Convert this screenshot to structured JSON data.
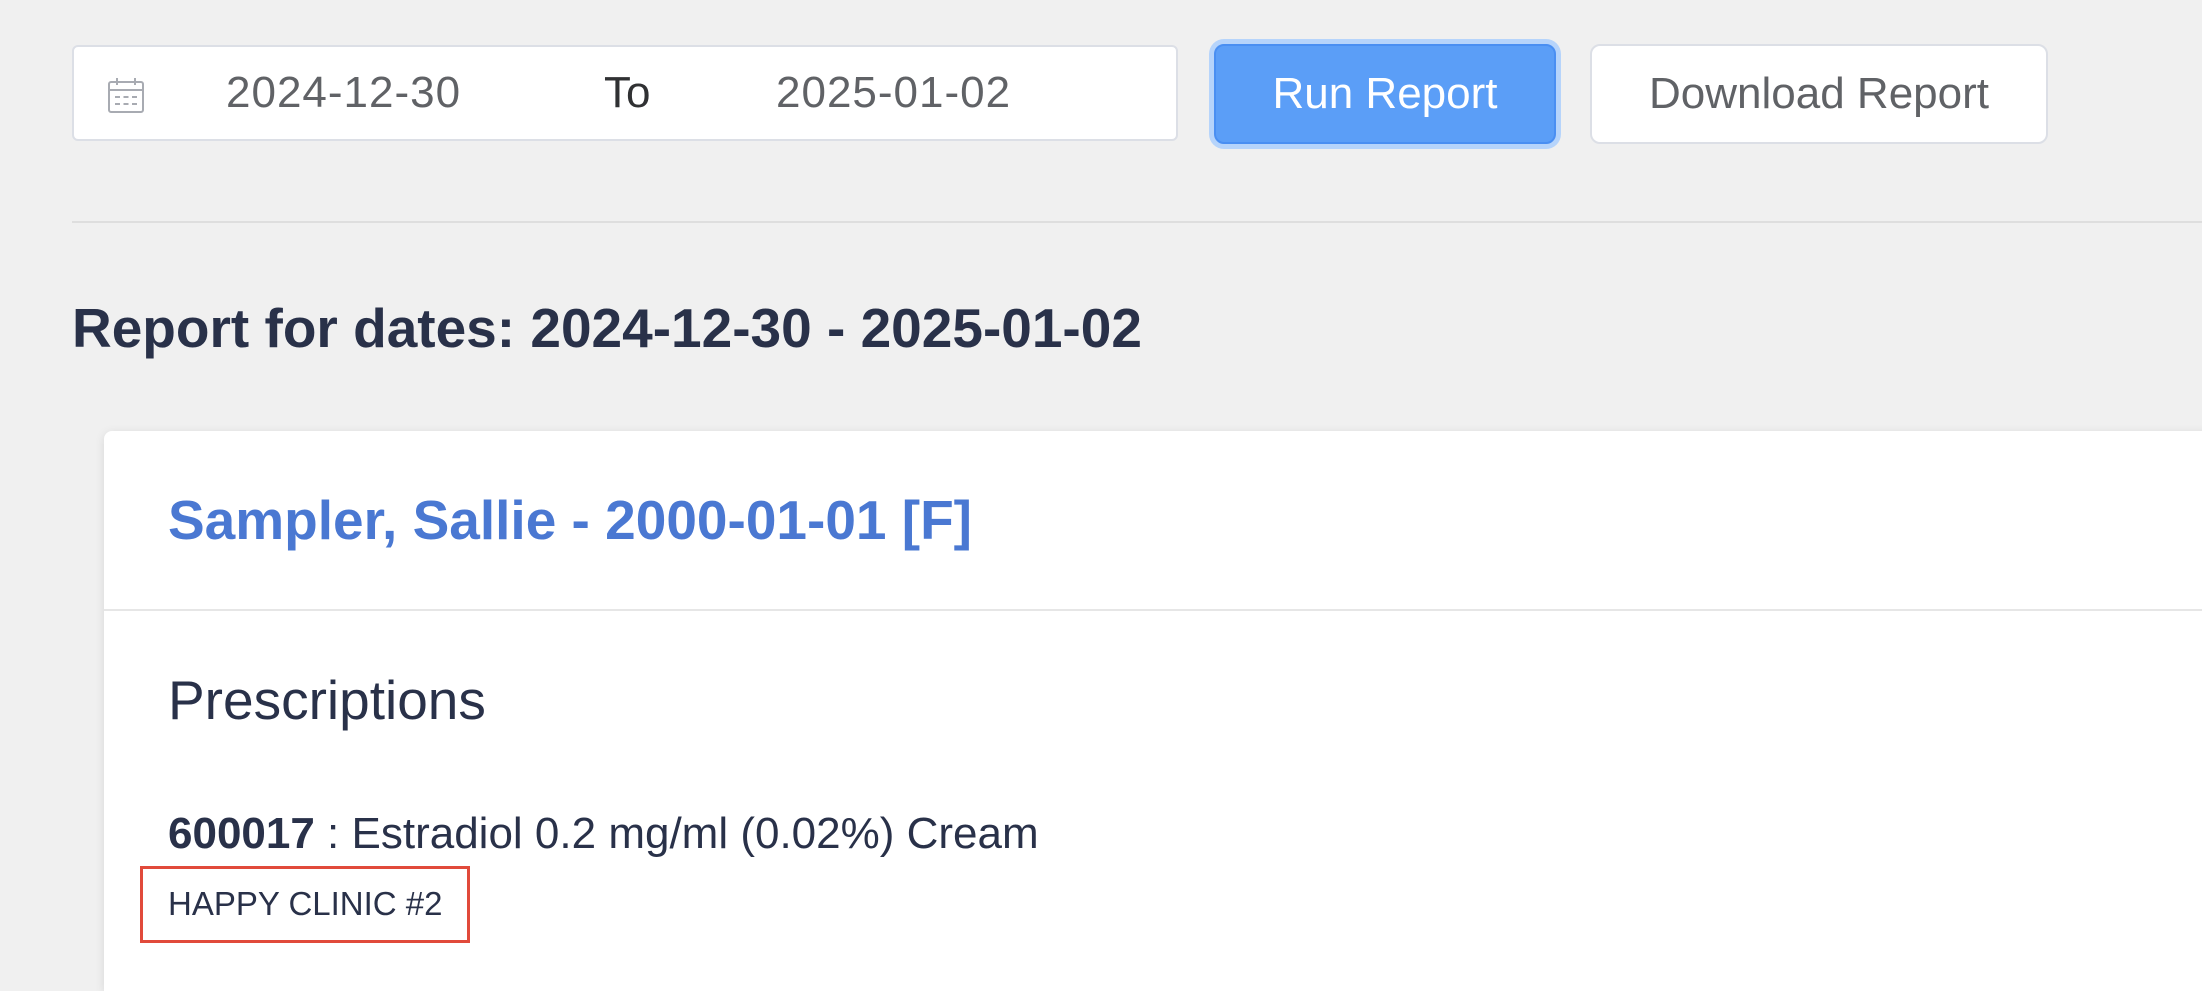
{
  "filters": {
    "calendar_icon": "calendar-icon",
    "start_date": "2024-12-30",
    "separator": "To",
    "end_date": "2025-01-02"
  },
  "buttons": {
    "run_report": "Run Report",
    "download_report": "Download Report"
  },
  "report": {
    "title": "Report for dates: 2024-12-30 - 2025-01-02"
  },
  "patient": {
    "name": "Sampler, Sallie - 2000-01-01 [F]",
    "section_title": "Prescriptions",
    "prescriptions": [
      {
        "code": "600017",
        "separator": " : ",
        "description": "Estradiol 0.2 mg/ml (0.02%) Cream",
        "pharmacy": "HAPPY CLINIC #2"
      }
    ]
  },
  "colors": {
    "background": "#f0f0f0",
    "primary_button": "#5b9ef7",
    "patient_link": "#4a78d2",
    "text": "#293149",
    "highlight_border": "#e14a3b"
  }
}
